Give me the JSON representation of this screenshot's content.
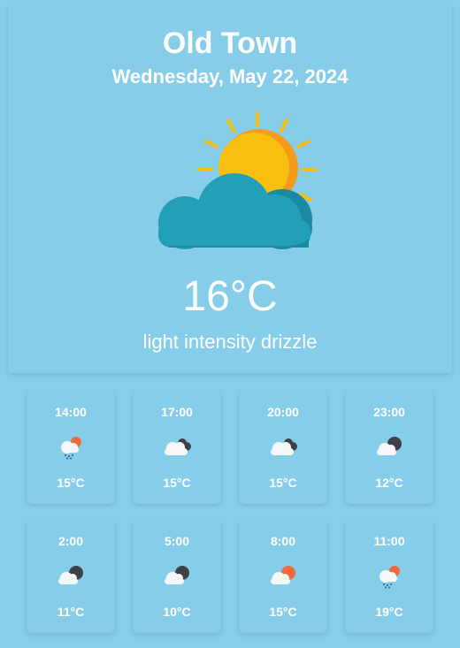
{
  "current": {
    "city": "Old Town",
    "date": "Wednesday, May 22, 2024",
    "temperature": "16°C",
    "description": "light intensity drizzle",
    "icon": "sun-behind-cloud-icon"
  },
  "forecast": [
    {
      "time": "14:00",
      "temp": "15°C",
      "icon": "rain-sun-cloud-icon"
    },
    {
      "time": "17:00",
      "temp": "15°C",
      "icon": "cloud-moon-icon"
    },
    {
      "time": "20:00",
      "temp": "15°C",
      "icon": "cloud-moon-icon"
    },
    {
      "time": "23:00",
      "temp": "12°C",
      "icon": "moon-cloud-icon"
    },
    {
      "time": "2:00",
      "temp": "11°C",
      "icon": "moon-cloud-icon"
    },
    {
      "time": "5:00",
      "temp": "10°C",
      "icon": "moon-cloud-icon"
    },
    {
      "time": "8:00",
      "temp": "15°C",
      "icon": "sun-cloud-icon"
    },
    {
      "time": "11:00",
      "temp": "19°C",
      "icon": "rain-sun-cloud-icon"
    }
  ],
  "colors": {
    "background": "#87ceeb",
    "sun": "#f9bf0f",
    "sun_shade": "#f39c1a",
    "cloud_main": "#23a0b8",
    "cloud_dark": "#1a8aa0",
    "small_cloud": "#f5f7f8",
    "moon": "#3f4148",
    "small_sun": "#f26a3c",
    "rain": "#2d6f93"
  }
}
